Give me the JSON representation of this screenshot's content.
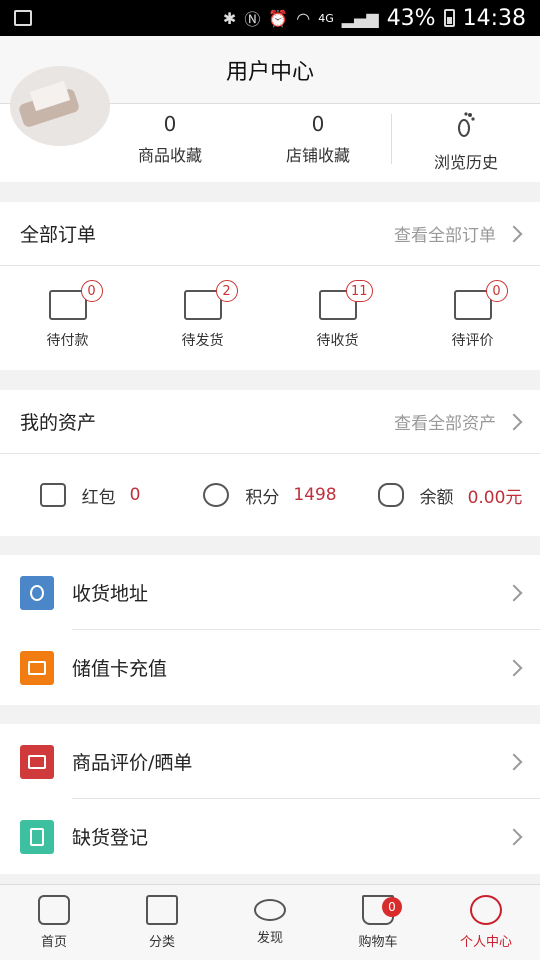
{
  "statusbar": {
    "battery": "43%",
    "network": "4G",
    "time": "14:38"
  },
  "navbar": {
    "title": "用户中心"
  },
  "user_stats": [
    {
      "value": "0",
      "label": "商品收藏"
    },
    {
      "value": "0",
      "label": "店铺收藏"
    },
    {
      "label": "浏览历史"
    }
  ],
  "orders": {
    "title": "全部订单",
    "link": "查看全部订单",
    "items": [
      {
        "label": "待付款",
        "badge": "0"
      },
      {
        "label": "待发货",
        "badge": "2"
      },
      {
        "label": "待收货",
        "badge": "11"
      },
      {
        "label": "待评价",
        "badge": "0"
      }
    ]
  },
  "assets": {
    "title": "我的资产",
    "link": "查看全部资产",
    "items": [
      {
        "label": "红包",
        "value": "0"
      },
      {
        "label": "积分",
        "value": "1498"
      },
      {
        "label": "余额",
        "value": "0.00元"
      }
    ]
  },
  "menu1": [
    {
      "label": "收货地址",
      "color": "#4a86c8"
    },
    {
      "label": "储值卡充值",
      "color": "#f07c12"
    }
  ],
  "menu2": [
    {
      "label": "商品评价/晒单",
      "color": "#d03a3a"
    },
    {
      "label": "缺货登记",
      "color": "#3cc0a0"
    }
  ],
  "tabbar": {
    "items": [
      {
        "label": "首页"
      },
      {
        "label": "分类"
      },
      {
        "label": "发现"
      },
      {
        "label": "购物车",
        "badge": "0"
      },
      {
        "label": "个人中心"
      }
    ],
    "active_color": "#c8202d"
  }
}
